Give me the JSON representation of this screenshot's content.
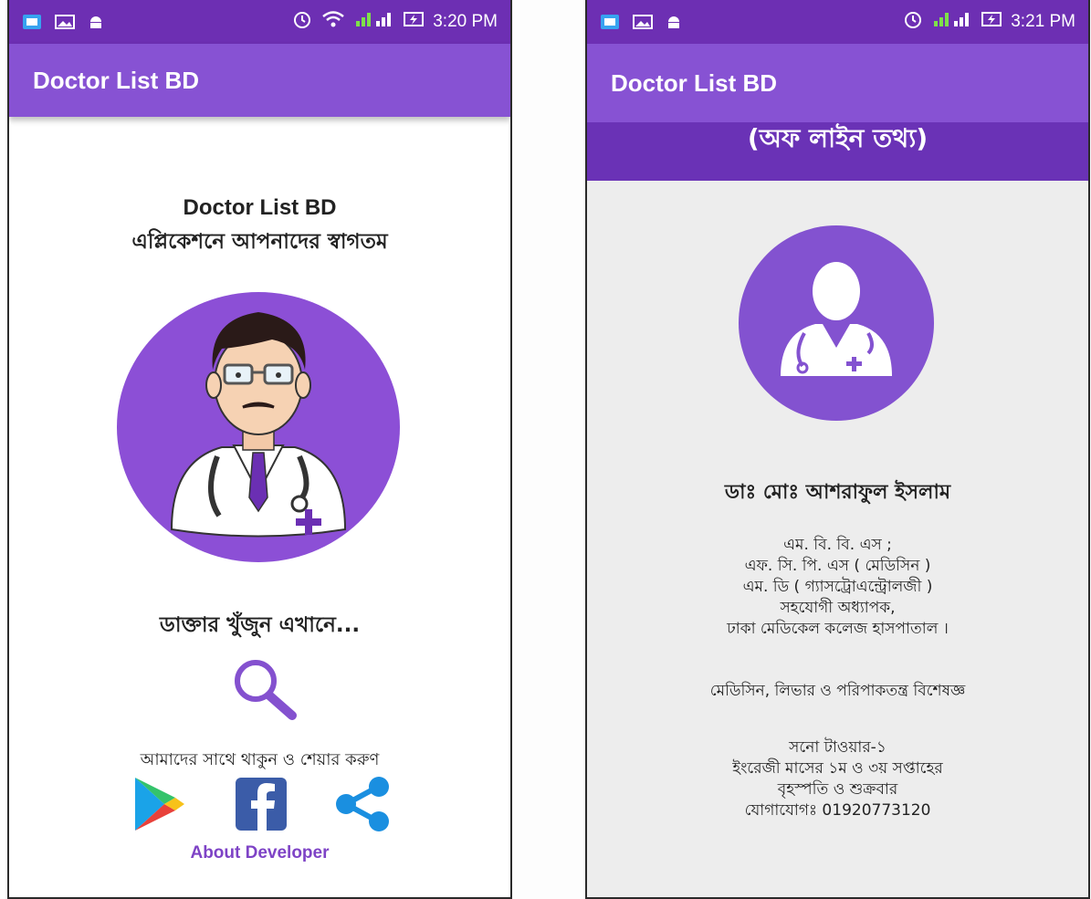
{
  "phone1": {
    "statusbar": {
      "time": "3:20 PM"
    },
    "appbar": {
      "title": "Doctor List BD"
    },
    "welcome": {
      "line1": "Doctor List BD",
      "line2": "এপ্লিকেশনে আপনাদের স্বাগতম"
    },
    "find_label": "ডাক্তার খুঁজুন এখানে...",
    "stay_label": "আমাদের সাথে থাকুন ও শেয়ার করুণ",
    "about_label": "About Developer"
  },
  "phone2": {
    "statusbar": {
      "time": "3:21 PM"
    },
    "appbar": {
      "title": "Doctor List BD"
    },
    "banner": "(অফ লাইন তথ্য)",
    "doctor": {
      "name": "ডাঃ মোঃ আশরাফুল ইসলাম",
      "degrees": [
        "এম. বি. বি. এস ;",
        "এফ. সি. পি. এস ( মেডিসিন )",
        "এম. ডি ( গ্যাসট্রোএন্ট্রোলজী )",
        "সহযোগী অধ্যাপক,",
        "ঢাকা মেডিকেল কলেজ হাসপাতাল ।"
      ],
      "specialty": "মেডিসিন, লিভার ও পরিপাকতন্ত্র বিশেষজ্ঞ",
      "chamber": [
        "সনো টাওয়ার-১",
        "ইংরেজী মাসের ১ম ও ৩য় সপ্তাহের",
        "বৃহস্পতি ও শুক্রবার",
        "যোগাযোগঃ 01920773120"
      ]
    }
  },
  "colors": {
    "statusbar": "#6d2fb3",
    "appbar": "#8752d3",
    "accent": "#8c4fd6",
    "banner": "#6a32b6"
  },
  "icons": [
    "gallery-icon",
    "image-icon",
    "android-icon",
    "alarm-icon",
    "wifi-icon",
    "signal-icon",
    "battery-icon",
    "search-icon",
    "play-store-icon",
    "facebook-icon",
    "share-icon",
    "doctor-avatar",
    "doctor-silhouette"
  ]
}
